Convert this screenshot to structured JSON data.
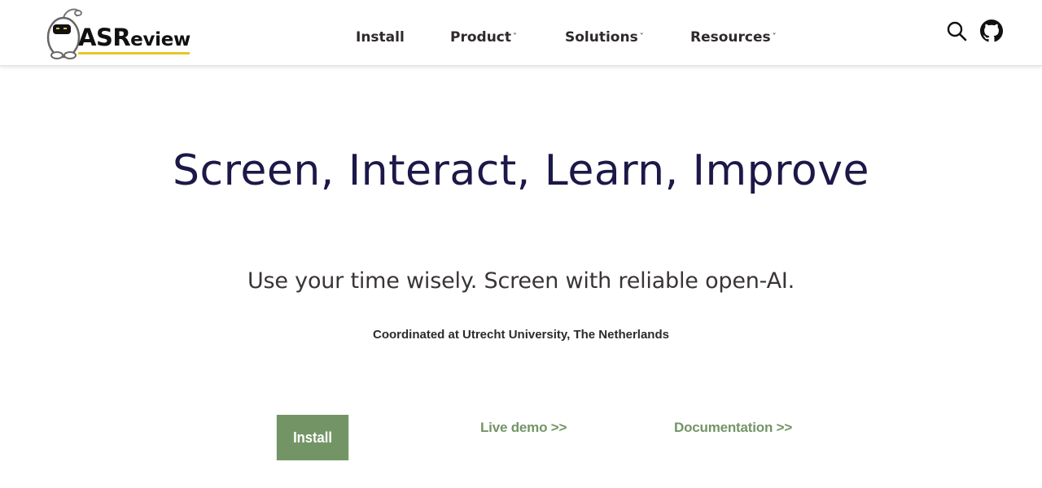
{
  "brand": {
    "name_prefix": "ASR",
    "name_suffix": "eview"
  },
  "nav": {
    "items": [
      {
        "label": "Install",
        "has_dropdown": false
      },
      {
        "label": "Product",
        "has_dropdown": true
      },
      {
        "label": "Solutions",
        "has_dropdown": true
      },
      {
        "label": "Resources",
        "has_dropdown": true
      }
    ],
    "dropdown_glyph": "˅"
  },
  "header_icons": [
    "search-icon",
    "github-icon"
  ],
  "hero": {
    "title": "Screen, Interact, Learn, Improve",
    "subtitle": "Use your time wisely. Screen with reliable open-AI.",
    "coordination": "Coordinated at Utrecht University, The Netherlands"
  },
  "cta": {
    "install_label": "Install",
    "live_demo_label": "Live demo >>",
    "documentation_label": "Documentation >>"
  },
  "colors": {
    "title": "#1c1848",
    "accent_green": "#739566",
    "logo_underline": "#e8c726"
  }
}
